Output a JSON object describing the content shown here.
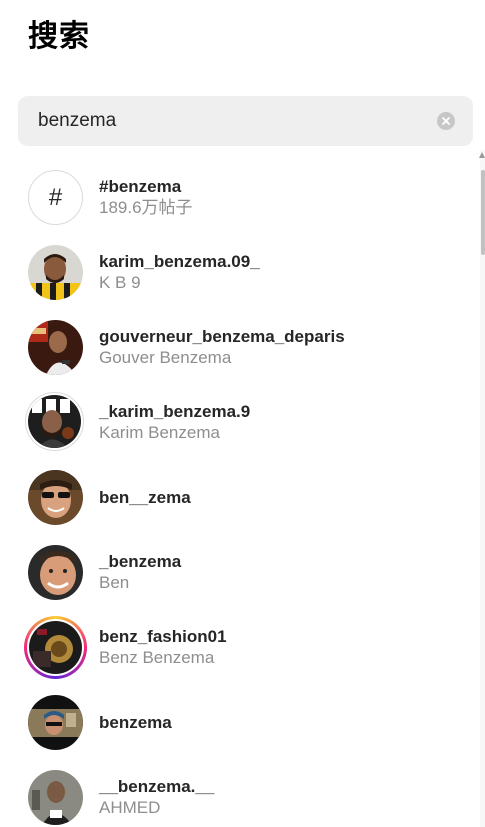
{
  "header": {
    "title": "搜索"
  },
  "search": {
    "value": "benzema",
    "clear_icon": "clear-circle-icon"
  },
  "results": [
    {
      "type": "hashtag",
      "username": "#benzema",
      "subtitle": "189.6万帖子",
      "icon": "hashtag-icon"
    },
    {
      "type": "user",
      "username": "karim_benzema.09_",
      "subtitle": "K B 9"
    },
    {
      "type": "user",
      "username": "gouverneur_benzema_deparis",
      "subtitle": "Gouver Benzema"
    },
    {
      "type": "user",
      "username": "_karim_benzema.9",
      "subtitle": "Karim Benzema"
    },
    {
      "type": "user",
      "username": "ben__zema",
      "subtitle": ""
    },
    {
      "type": "user",
      "username": "_benzema",
      "subtitle": "Ben"
    },
    {
      "type": "user",
      "username": "benz_fashion01",
      "subtitle": "Benz Benzema",
      "has_story": true
    },
    {
      "type": "user",
      "username": "benzema",
      "subtitle": ""
    },
    {
      "type": "user",
      "username": "__benzema.__",
      "subtitle": "AHMED"
    }
  ],
  "hashtag_glyph": "#",
  "colors": {
    "search_bg": "#efefef",
    "secondary_text": "#8e8e8e",
    "story_ring": "#ee2a7b"
  }
}
